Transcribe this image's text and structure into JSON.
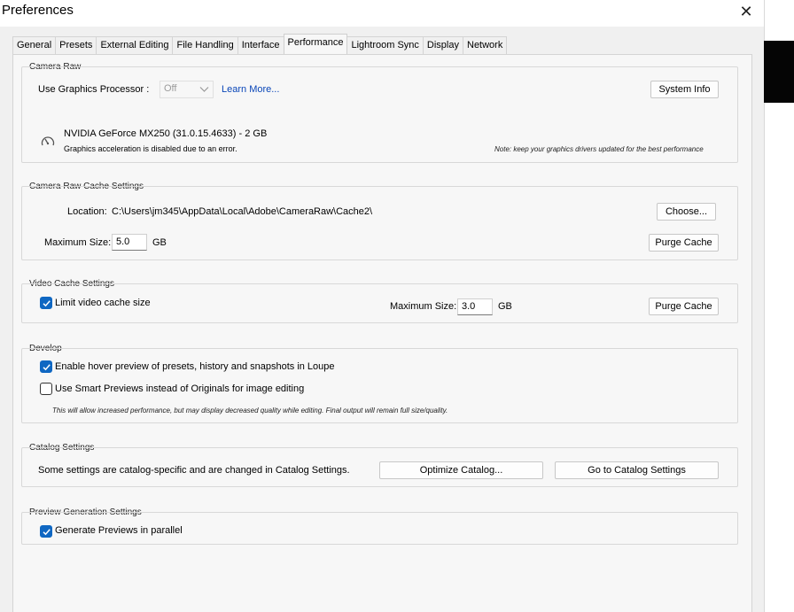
{
  "window": {
    "title": "Preferences",
    "close_icon": "close-icon"
  },
  "tabs": [
    {
      "label": "General"
    },
    {
      "label": "Presets"
    },
    {
      "label": "External Editing"
    },
    {
      "label": "File Handling"
    },
    {
      "label": "Interface"
    },
    {
      "label": "Performance",
      "active": true
    },
    {
      "label": "Lightroom Sync"
    },
    {
      "label": "Display"
    },
    {
      "label": "Network"
    }
  ],
  "camera_raw": {
    "group_label": "Camera Raw",
    "gpu_label": "Use Graphics Processor :",
    "gpu_value": "Off",
    "learn_more": "Learn More...",
    "system_info_button": "System Info",
    "gpu_name": "NVIDIA GeForce MX250 (31.0.15.4633) - 2 GB",
    "gpu_status": "Graphics acceleration is disabled due to an error.",
    "note": "Note: keep your graphics drivers updated for the best performance",
    "gpu_icon": "gauge-icon"
  },
  "cache": {
    "group_label": "Camera Raw Cache Settings",
    "location_label": "Location:",
    "location_value": "C:\\Users\\jm345\\AppData\\Local\\Adobe\\CameraRaw\\Cache2\\",
    "choose_button": "Choose...",
    "max_size_label": "Maximum Size:",
    "max_size_value": "5.0",
    "unit": "GB",
    "purge_button": "Purge Cache"
  },
  "video_cache": {
    "group_label": "Video Cache Settings",
    "limit_label": "Limit video cache size",
    "limit_checked": true,
    "max_size_label": "Maximum Size:",
    "max_size_value": "3.0",
    "unit": "GB",
    "purge_button": "Purge Cache"
  },
  "develop": {
    "group_label": "Develop",
    "hover_preview_label": "Enable hover preview of presets, history and snapshots in Loupe",
    "hover_preview_checked": true,
    "smart_previews_label": "Use Smart Previews instead of Originals for image editing",
    "smart_previews_checked": false,
    "note": "This will allow increased performance, but may display decreased quality while editing. Final output will remain full size/quality."
  },
  "catalog": {
    "group_label": "Catalog Settings",
    "description": "Some settings are catalog-specific and are changed in Catalog Settings.",
    "optimize_button": "Optimize Catalog...",
    "goto_button": "Go to Catalog Settings"
  },
  "preview_generation": {
    "group_label": "Preview Generation Settings",
    "parallel_label": "Generate Previews in parallel",
    "parallel_checked": true
  },
  "colors": {
    "accent": "#0f67c2",
    "link": "#0a46b8"
  }
}
